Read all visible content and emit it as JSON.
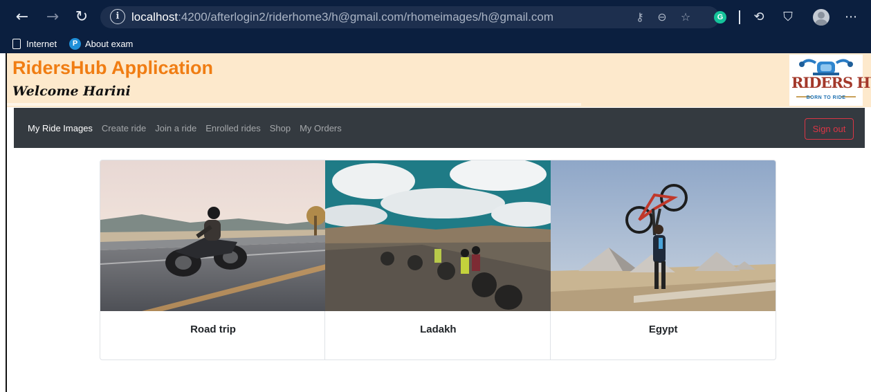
{
  "browser": {
    "url_host": "localhost",
    "url_path": ":4200/afterlogin2/riderhome3/h@gmail.com/rhomeimages/h@gmail.com",
    "favorites": [
      {
        "label": "Internet",
        "icon": "page-icon"
      },
      {
        "label": "About exam",
        "icon": "p-badge-icon"
      }
    ],
    "grammarly_letter": "G"
  },
  "header": {
    "app_title": "RidersHub Application",
    "welcome": "Welcome Harini",
    "logo_text": "RIDERS HUB",
    "logo_tagline": "BORN TO RIDE"
  },
  "nav": {
    "items": [
      {
        "label": "My Ride Images",
        "active": true
      },
      {
        "label": "Create ride",
        "active": false
      },
      {
        "label": "Join a ride",
        "active": false
      },
      {
        "label": "Enrolled rides",
        "active": false
      },
      {
        "label": "Shop",
        "active": false
      },
      {
        "label": "My Orders",
        "active": false
      }
    ],
    "signout_label": "Sign out"
  },
  "cards": [
    {
      "title": "Road trip"
    },
    {
      "title": "Ladakh"
    },
    {
      "title": "Egypt"
    }
  ],
  "colors": {
    "chrome": "#0b1f3f",
    "header_bg": "#fde9cc",
    "title_orange": "#f07d13",
    "navbar": "#343a40",
    "danger": "#dc3545"
  }
}
